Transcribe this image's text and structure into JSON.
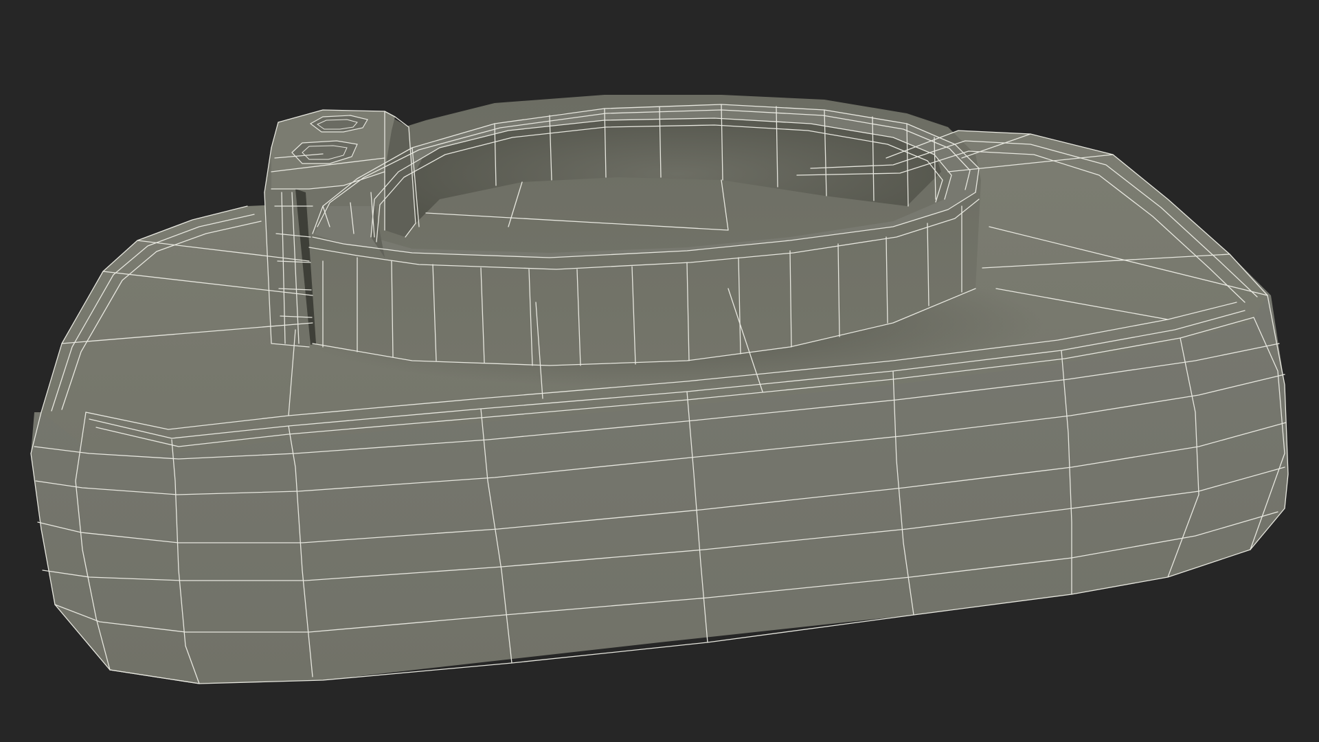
{
  "scene": {
    "subject": "wireframe-mesh-render",
    "render_mode": "shaded-wireframe",
    "colors": {
      "background": "#262626",
      "surface_light": "#7a7b70",
      "surface_mid": "#6f7066",
      "surface_dark": "#55564d",
      "surface_shadow": "#4a4b43",
      "wire": "#e8e8e0"
    }
  }
}
